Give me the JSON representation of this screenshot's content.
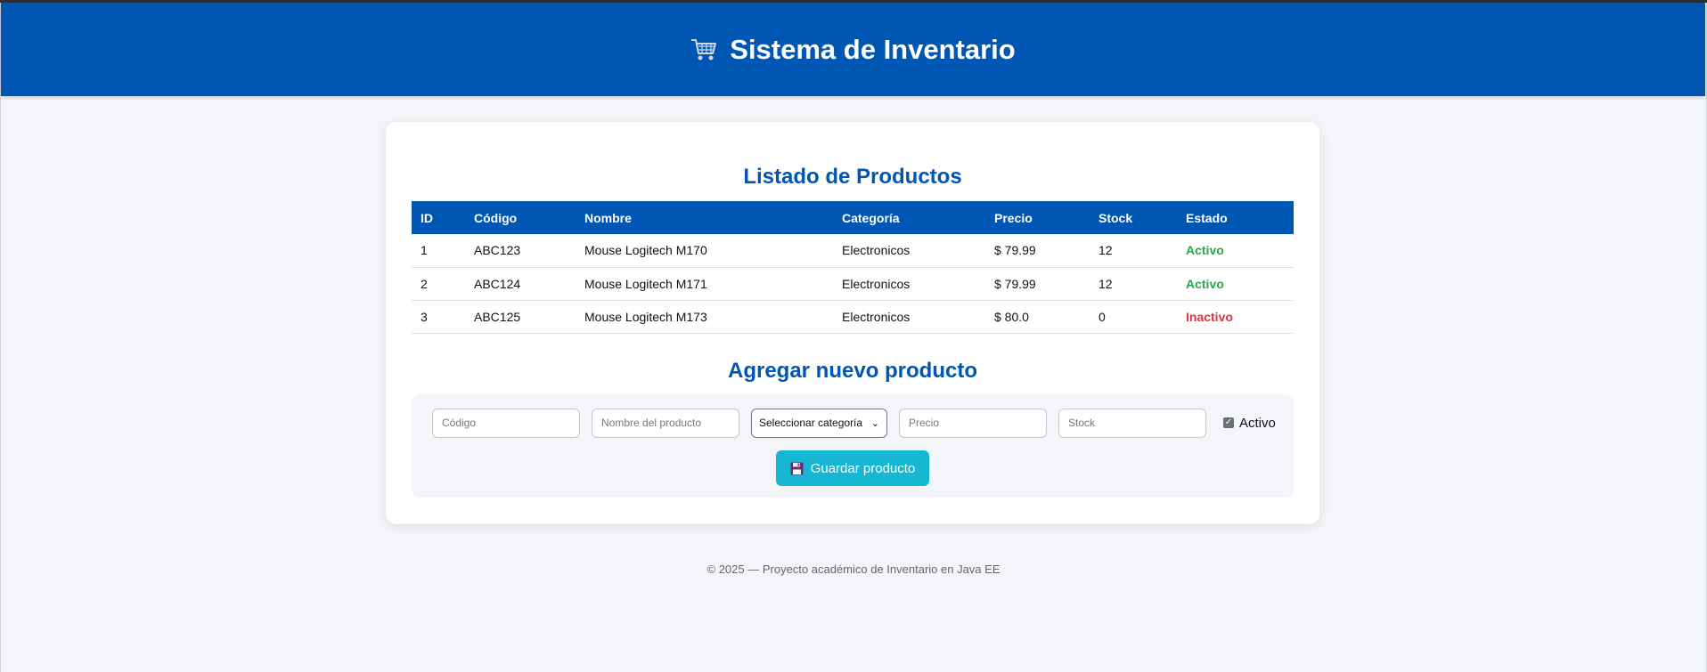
{
  "header": {
    "title": "Sistema de Inventario",
    "icon": "shopping-cart-icon"
  },
  "products": {
    "title": "Listado de Productos",
    "columns": [
      "ID",
      "Código",
      "Nombre",
      "Categoría",
      "Precio",
      "Stock",
      "Estado"
    ],
    "rows": [
      {
        "id": "1",
        "codigo": "ABC123",
        "nombre": "Mouse Logitech M170",
        "categoria": "Electronicos",
        "precio": "$ 79.99",
        "stock": "12",
        "estado": "Activo"
      },
      {
        "id": "2",
        "codigo": "ABC124",
        "nombre": "Mouse Logitech M171",
        "categoria": "Electronicos",
        "precio": "$ 79.99",
        "stock": "12",
        "estado": "Activo"
      },
      {
        "id": "3",
        "codigo": "ABC125",
        "nombre": "Mouse Logitech M173",
        "categoria": "Electronicos",
        "precio": "$ 80.0",
        "stock": "0",
        "estado": "Inactivo"
      }
    ]
  },
  "form": {
    "title": "Agregar nuevo producto",
    "codigo_placeholder": "Código",
    "nombre_placeholder": "Nombre del producto",
    "categoria_selected": "Seleccionar categoría",
    "precio_placeholder": "Precio",
    "stock_placeholder": "Stock",
    "activo_label": "Activo",
    "activo_checked": true,
    "save_label": "Guardar producto",
    "save_icon": "floppy-disk-icon"
  },
  "footer": {
    "text": "© 2025 — Proyecto académico de Inventario en Java EE"
  },
  "colors": {
    "primary": "#0056b3",
    "active": "#28a745",
    "inactive": "#dc3545",
    "button": "#17b6d3"
  }
}
